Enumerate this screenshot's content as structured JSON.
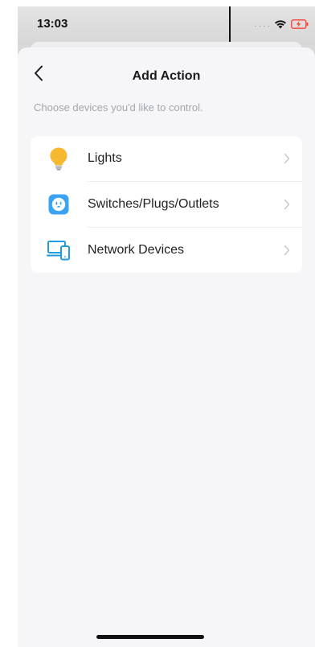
{
  "status_bar": {
    "time": "13:03",
    "icons": [
      "signal-dots",
      "wifi-icon",
      "battery-charging-icon"
    ],
    "battery_color": "#ff3b30"
  },
  "header": {
    "back_icon": "chevron-left-icon",
    "title": "Add Action"
  },
  "subtitle": "Choose devices you'd like to control.",
  "devices": [
    {
      "label": "Lights",
      "icon": "lightbulb-icon",
      "icon_color": "#f5b82e"
    },
    {
      "label": "Switches/Plugs/Outlets",
      "icon": "smart-plug-icon",
      "icon_color": "#3aa3f2"
    },
    {
      "label": "Network Devices",
      "icon": "network-devices-icon",
      "icon_color": "#1e9ce0"
    }
  ],
  "colors": {
    "sheet_bg": "#f6f6f9",
    "card_bg": "#ffffff",
    "subtitle_text": "#a3a6ad",
    "chevron": "#c4c6cb"
  }
}
